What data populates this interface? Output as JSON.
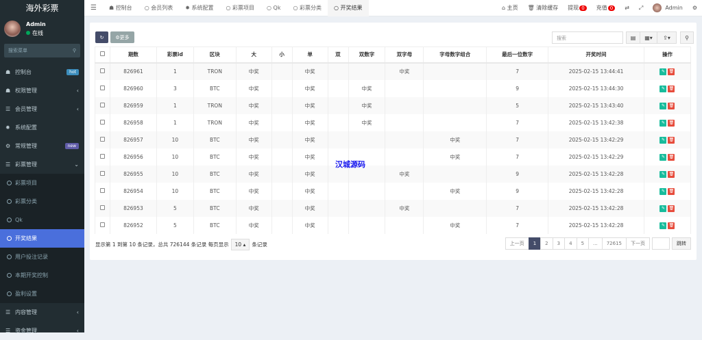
{
  "app": {
    "title": "海外彩票"
  },
  "user": {
    "name": "Admin",
    "status": "在线"
  },
  "sidebar": {
    "search_placeholder": "搜索菜单",
    "items": [
      {
        "label": "控制台",
        "icon": "dashboard-icon",
        "badge": "hot",
        "badge_color": "#3c8dbc"
      },
      {
        "label": "权限管理",
        "icon": "users-icon",
        "arrow": "‹"
      },
      {
        "label": "会员管理",
        "icon": "list-icon",
        "arrow": "‹"
      },
      {
        "label": "系统配置",
        "icon": "gear-icon"
      },
      {
        "label": "常规管理",
        "icon": "cogs-icon",
        "badge": "new",
        "badge_color": "#605ca8"
      },
      {
        "label": "彩票管理",
        "icon": "list-icon",
        "arrow": "⌄"
      }
    ],
    "sub": [
      "彩票项目",
      "彩票分类",
      "Qk",
      "开奖结果",
      "用户投注记录",
      "本期开奖控制",
      "盈利设置"
    ],
    "sub_active": 3,
    "after": [
      {
        "label": "内容管理",
        "arrow": "‹"
      },
      {
        "label": "资金管理",
        "arrow": "‹"
      }
    ]
  },
  "tabs": [
    {
      "label": "控制台",
      "icon": "dashboard-icon"
    },
    {
      "label": "会员列表",
      "icon": "circle-icon"
    },
    {
      "label": "系统配置",
      "icon": "gear-icon"
    },
    {
      "label": "彩票项目",
      "icon": "circle-icon"
    },
    {
      "label": "Qk",
      "icon": "circle-icon"
    },
    {
      "label": "彩票分类",
      "icon": "circle-icon"
    },
    {
      "label": "开奖结果",
      "icon": "circle-icon",
      "active": true
    }
  ],
  "topright": {
    "home": "主页",
    "clear_cache": "清除缓存",
    "withdraw": "提现",
    "withdraw_count": "0",
    "recharge": "充值",
    "recharge_count": "0",
    "admin": "Admin"
  },
  "toolbar": {
    "more": "更多",
    "search_placeholder": "搜索"
  },
  "table": {
    "headers": [
      "期数",
      "彩票id",
      "区块",
      "大",
      "小",
      "单",
      "双",
      "双数字",
      "双字母",
      "字母数字组合",
      "最后一位数字",
      "开奖时间",
      "操作"
    ],
    "rows": [
      [
        "826961",
        "1",
        "TRON",
        "中奖",
        "",
        "中奖",
        "",
        "",
        "中奖",
        "",
        "7",
        "2025-02-15 13:44:41"
      ],
      [
        "826960",
        "3",
        "BTC",
        "中奖",
        "",
        "中奖",
        "",
        "中奖",
        "",
        "",
        "9",
        "2025-02-15 13:44:30"
      ],
      [
        "826959",
        "1",
        "TRON",
        "中奖",
        "",
        "中奖",
        "",
        "中奖",
        "",
        "",
        "5",
        "2025-02-15 13:43:40"
      ],
      [
        "826958",
        "1",
        "TRON",
        "中奖",
        "",
        "中奖",
        "",
        "中奖",
        "",
        "",
        "7",
        "2025-02-15 13:42:38"
      ],
      [
        "826957",
        "10",
        "BTC",
        "中奖",
        "",
        "中奖",
        "",
        "",
        "",
        "中奖",
        "7",
        "2025-02-15 13:42:29"
      ],
      [
        "826956",
        "10",
        "BTC",
        "中奖",
        "",
        "中奖",
        "",
        "",
        "",
        "中奖",
        "7",
        "2025-02-15 13:42:29"
      ],
      [
        "826955",
        "10",
        "BTC",
        "中奖",
        "",
        "中奖",
        "",
        "",
        "中奖",
        "",
        "9",
        "2025-02-15 13:42:28"
      ],
      [
        "826954",
        "10",
        "BTC",
        "中奖",
        "",
        "中奖",
        "",
        "",
        "",
        "中奖",
        "9",
        "2025-02-15 13:42:28"
      ],
      [
        "826953",
        "5",
        "BTC",
        "中奖",
        "",
        "中奖",
        "",
        "",
        "中奖",
        "",
        "7",
        "2025-02-15 13:42:28"
      ],
      [
        "826952",
        "5",
        "BTC",
        "中奖",
        "",
        "中奖",
        "",
        "",
        "",
        "中奖",
        "7",
        "2025-02-15 13:42:28"
      ]
    ]
  },
  "footer": {
    "summary": "显示第 1 到第 10 条记录，总共 726144 条记录 每页显示",
    "per_page": "10",
    "suffix": "条记录"
  },
  "pagination": {
    "prev": "上一页",
    "pages": [
      "1",
      "2",
      "3",
      "4",
      "5",
      "...",
      "72615"
    ],
    "active": "1",
    "next": "下一页",
    "jump": "跳转"
  },
  "watermark": "汉城源码"
}
